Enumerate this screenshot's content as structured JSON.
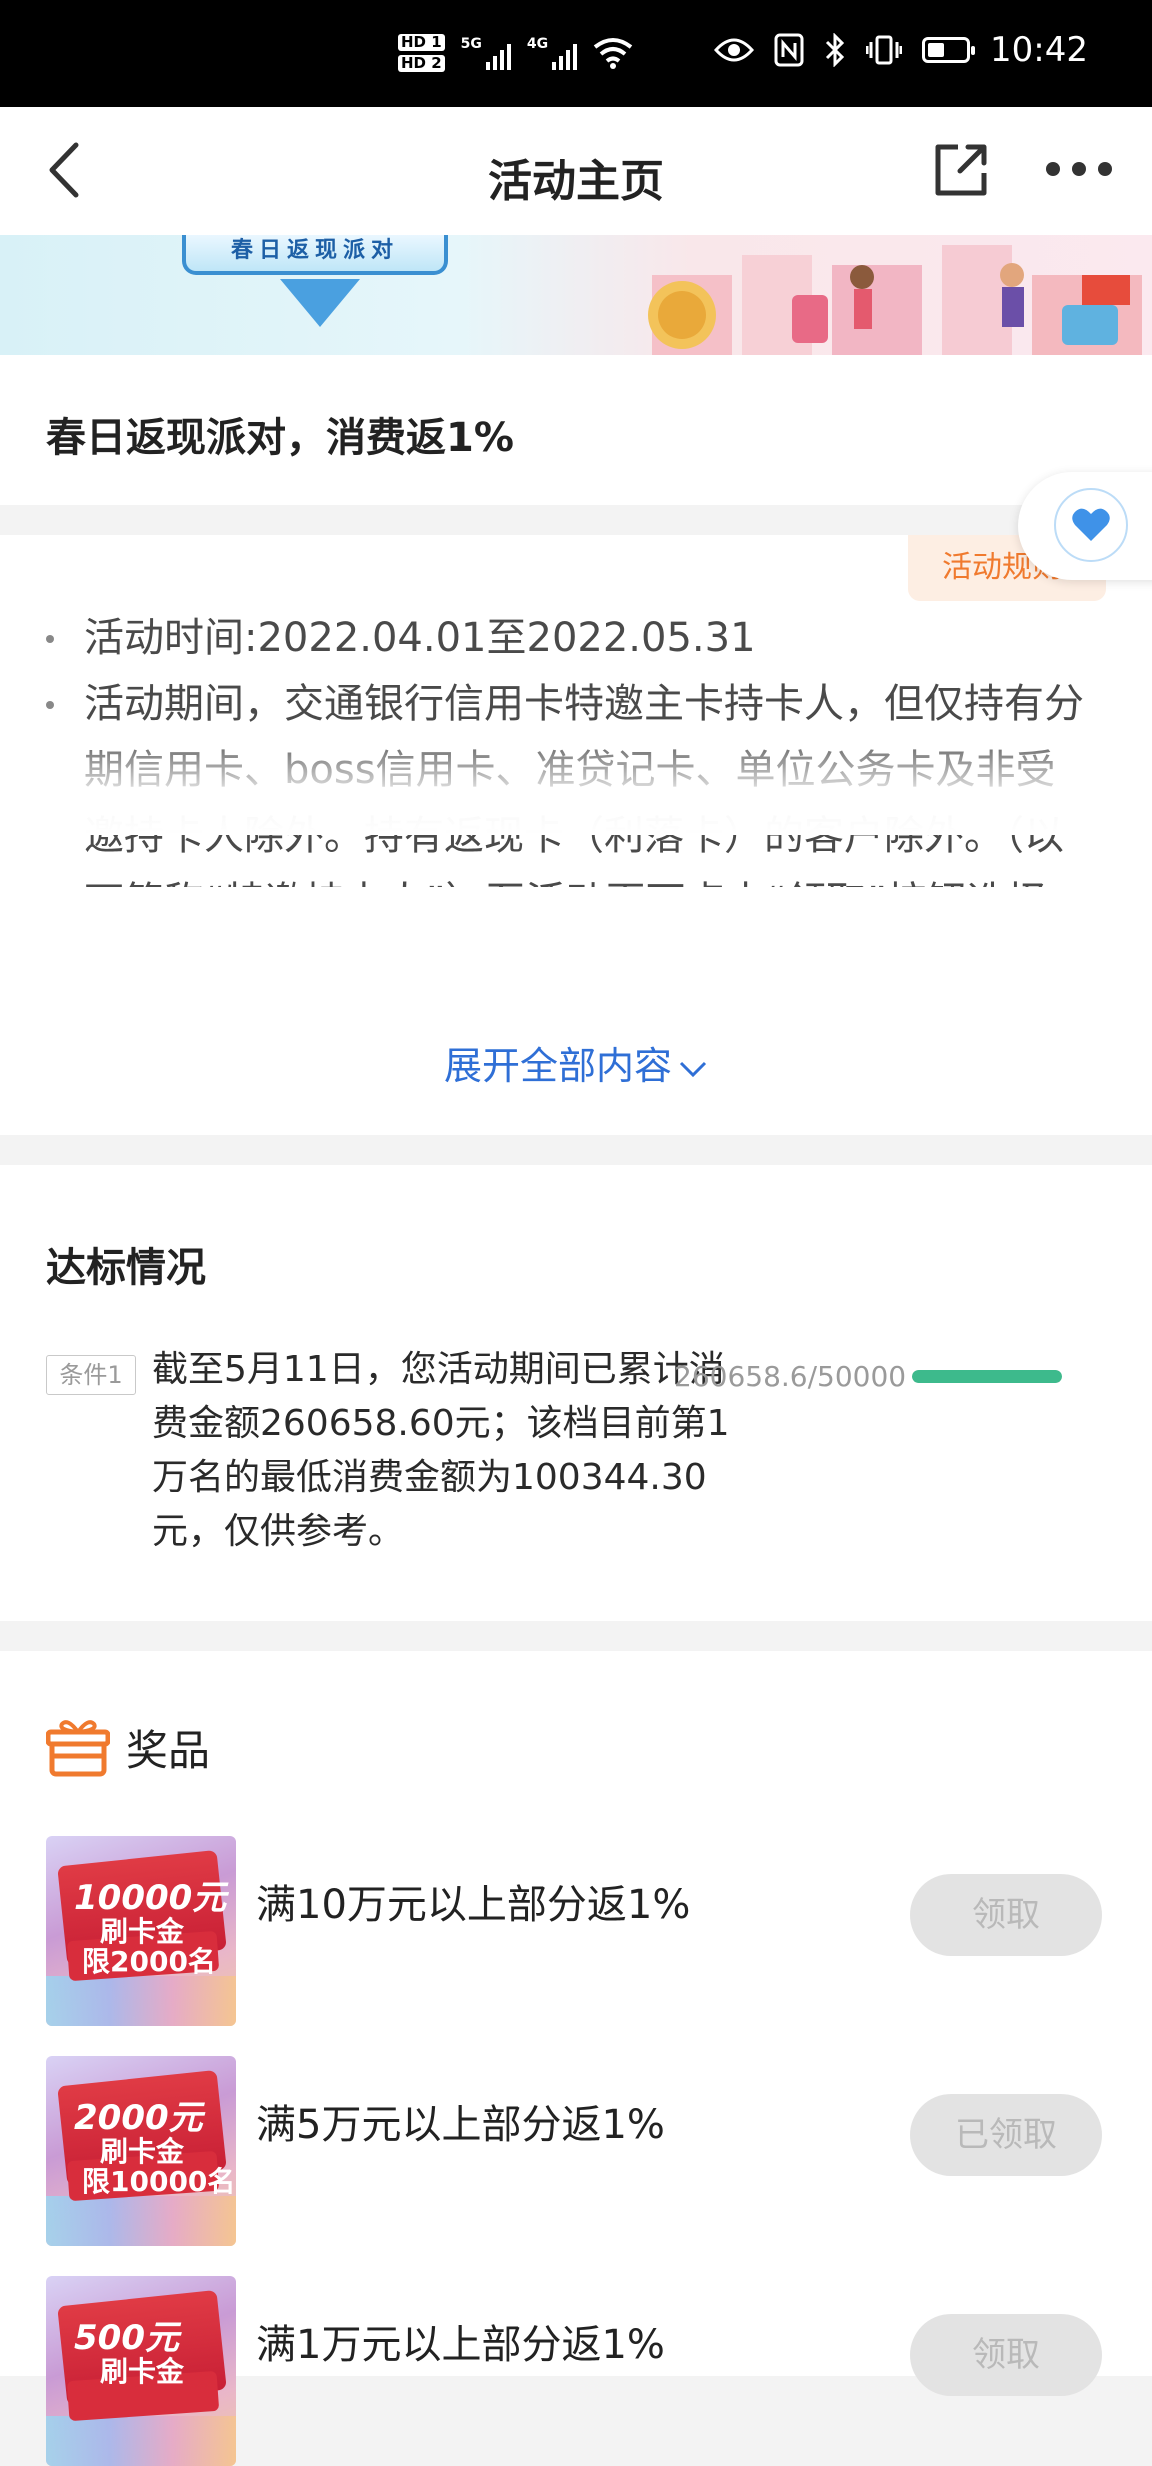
{
  "status_bar": {
    "hd1": "HD 1",
    "hd2": "HD 2",
    "net1": "5G",
    "net2": "4G",
    "time": "10:42"
  },
  "nav": {
    "title": "活动主页"
  },
  "banner": {
    "badge_text": "春日返现派对"
  },
  "promo_title": "春日返现派对，消费返1%",
  "rules": {
    "tag": "活动规则",
    "items": [
      "活动时间:2022.04.01至2022.05.31",
      "活动期间，交通银行信用卡特邀主卡持卡人，但仅持有分期信用卡、boss信用卡、准贷记卡、单位公务卡及非受邀持卡人除外。持有返现卡（利落卡）的客户除外。（以下简称“特邀持卡人”）至活动页面点击“领取”按钮选择一个返现目标档次，并按照活动期间累计消费金额进行排名，排名成功后可按"
    ],
    "expand_label": "展开全部内容"
  },
  "progress": {
    "section_title": "达标情况",
    "condition_tag": "条件1",
    "condition_text": "截至5月11日，您活动期间已累计消费金额260658.60元；该档目前第1万名的最低消费金额为100344.30元，仅供参考。",
    "ratio_text": "260658.6/50000",
    "fill_fraction": 1.0,
    "bar_color": "#3dba8c"
  },
  "prizes": {
    "section_title": "奖品",
    "items": [
      {
        "img_amount": "10000元",
        "img_sub1": "刷卡金",
        "img_sub2": "限2000名",
        "name": "满10万元以上部分返1%",
        "button": "领取"
      },
      {
        "img_amount": "2000元",
        "img_sub1": "刷卡金",
        "img_sub2": "限10000名",
        "name": "满5万元以上部分返1%",
        "button": "已领取"
      },
      {
        "img_amount": "500元",
        "img_sub1": "刷卡金",
        "img_sub2": "",
        "name": "满1万元以上部分返1%",
        "button": "领取"
      }
    ]
  },
  "colors": {
    "accent_orange": "#f07a2e",
    "link_blue": "#2f6fd6",
    "progress_green": "#3dba8c"
  }
}
